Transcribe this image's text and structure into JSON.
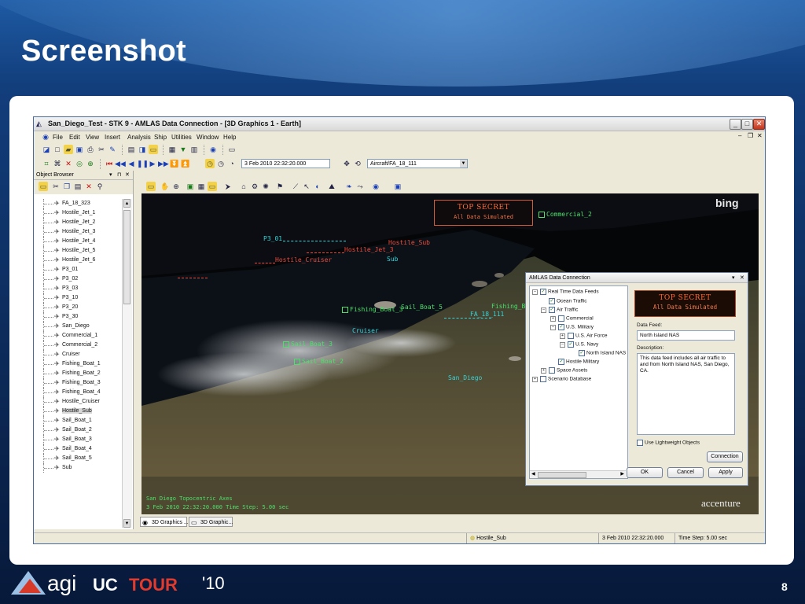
{
  "slide": {
    "title": "Screenshot",
    "page_number": "8"
  },
  "logo": {
    "agi": "agi",
    "uc": "UC",
    "tour": "TOUR",
    "year": "'10"
  },
  "window": {
    "title": "San_Diego_Test - STK 9 - AMLAS Data Connection - [3D Graphics 1 - Earth]",
    "menu": [
      "File",
      "Edit",
      "View",
      "Insert",
      "Analysis",
      "Ship",
      "Utilities",
      "Window",
      "Help"
    ],
    "time_field": "3 Feb 2010 22:32:20.000",
    "object_field": "Aircraft/FA_18_111"
  },
  "object_browser": {
    "title": "Object Browser",
    "items": [
      "FA_18_323",
      "Hostile_Jet_1",
      "Hostile_Jet_2",
      "Hostile_Jet_3",
      "Hostile_Jet_4",
      "Hostile_Jet_5",
      "Hostile_Jet_6",
      "P3_01",
      "P3_02",
      "P3_03",
      "P3_10",
      "P3_20",
      "P3_30",
      "San_Diego",
      "Commercial_1",
      "Commercial_2",
      "Cruiser",
      "Fishing_Boat_1",
      "Fishing_Boat_2",
      "Fishing_Boat_3",
      "Fishing_Boat_4",
      "Hostile_Cruiser",
      "Hostile_Sub",
      "Sail_Boat_1",
      "Sail_Boat_2",
      "Sail_Boat_3",
      "Sail_Boat_4",
      "Sail_Boat_5",
      "Sub"
    ],
    "selected": "Hostile_Sub"
  },
  "view": {
    "watermark": "bing",
    "brand": "accenture",
    "top_secret": "TOP SECRET",
    "all_data": "All Data Simulated",
    "labels": {
      "commercial_2": "Commercial_2",
      "p3_01": "P3_01",
      "hostile_sub": "Hostile_Sub",
      "hostile_jet_3": "Hostile_Jet_3",
      "hostile_cruiser": "Hostile_Cruiser",
      "sub": "Sub",
      "fishing_boat_3": "Fishing_Boat_3",
      "sail_boat_5": "Sail_Boat_5",
      "fishing_boat_1": "Fishing_Boat_1",
      "fa_18_111": "FA_18_111",
      "cruiser": "Cruiser",
      "sail_boat_3": "Sail_Boat_3",
      "sail_boat_2": "Sail_Boat_2",
      "san_diego": "San_Diego"
    },
    "footer_line1": "San Diego Topocentric Axes",
    "footer_line2": "3 Feb 2010 22:32:20.000    Time Step: 5.00 sec"
  },
  "tabs": [
    "3D Graphics ...",
    "3D Graphic..."
  ],
  "status": {
    "object": "Hostile_Sub",
    "time": "3 Feb 2010 22:32:20.000",
    "step": "Time Step: 5.00 sec"
  },
  "dialog": {
    "title": "AMLAS Data Connection",
    "tree": {
      "root": "Real Time Data Feeds",
      "ocean": "Ocean Traffic",
      "air": "Air Traffic",
      "commercial": "Commercial",
      "military": "U.S. Military",
      "airforce": "U.S. Air Force",
      "navy": "U.S. Navy",
      "nas": "North Island NAS",
      "hostile": "Hostile Military",
      "space": "Space Assets",
      "scenario": "Scenario Database"
    },
    "top_secret": "TOP SECRET",
    "all_data": "All Data Simulated",
    "data_feed_label": "Data Feed:",
    "data_feed_value": "North Island NAS",
    "description_label": "Description:",
    "description_text": "This data feed includes all air traffic to and from North Island NAS, San Diego, CA.",
    "lightweight": "Use Lightweight Objects",
    "connection": "Connection",
    "ok": "OK",
    "cancel": "Cancel",
    "apply": "Apply"
  }
}
